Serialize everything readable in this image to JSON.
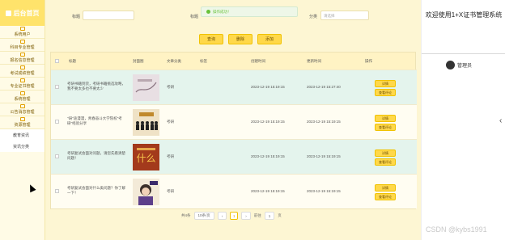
{
  "sidebar": {
    "header": "后台首页",
    "items": [
      {
        "label": "系统用户"
      },
      {
        "label": "科目专业管理"
      },
      {
        "label": "报名信息管理"
      },
      {
        "label": "考试成绩管理"
      },
      {
        "label": "专业证书管理"
      },
      {
        "label": "系统管理"
      },
      {
        "label": "公告消息管理"
      },
      {
        "label": "资源管理"
      }
    ],
    "subs": [
      {
        "label": "教育资讯"
      },
      {
        "label": "资讯分类"
      }
    ]
  },
  "search": {
    "label1": "标题",
    "label2": "标题",
    "label3": "分类",
    "select_placeholder": "请选择"
  },
  "toast": {
    "text": "操作成功！"
  },
  "buttons": {
    "query": "查询",
    "delete": "删除",
    "add": "添加"
  },
  "table": {
    "headers": [
      "标题",
      "封面图",
      "文章分类",
      "标签",
      "创建时间",
      "更新时间",
      "操作"
    ],
    "rows": [
      {
        "title": "考研书籍到货，考研书籍挑选攻略，我不要太多也不要太少",
        "category": "考研",
        "tag": "",
        "created": "2023-12-19 15:19:15",
        "updated": "2023-12-19 15:27:40",
        "action1": "详情",
        "action2": "查看评论"
      },
      {
        "title": "\"研\"途漫漫，青春奋斗大学院校\"考研\"经验分享",
        "category": "考研",
        "tag": "",
        "created": "2023-12-19 15:19:15",
        "updated": "2023-12-19 15:19:15",
        "action1": "详情",
        "action2": "查看评论"
      },
      {
        "title": "考研复试会面对问题，请您先看清楚问题！",
        "category": "考研",
        "tag": "",
        "created": "2023-12-19 15:19:15",
        "updated": "2023-12-19 15:19:15",
        "action1": "详情",
        "action2": "查看评论"
      },
      {
        "title": "考研复试会面对什么类问题？你了解一下！",
        "category": "考研",
        "tag": "",
        "created": "2023-12-19 15:19:15",
        "updated": "2023-12-19 15:19:15",
        "action1": "详情",
        "action2": "查看评论"
      }
    ]
  },
  "pagination": {
    "total": "共4条",
    "page_size": "10条/页",
    "prev": "‹",
    "current": "1",
    "next": "›",
    "goto": "前往",
    "goto_value": "1",
    "page": "页"
  },
  "right": {
    "welcome": "欢迎使用1+X证书管理系统",
    "user": "管理员",
    "chevron": "‹"
  },
  "watermark": "CSDN @kybs1991",
  "colors": {
    "accent": "#ffd84a",
    "header": "#ffe36b",
    "alt_row": "#e4f4ed"
  }
}
